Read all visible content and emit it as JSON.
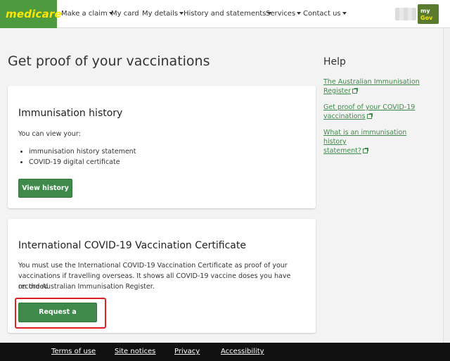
{
  "brand": {
    "name": "medicare",
    "color": "#4e9a3e",
    "text_color": "#ffe600"
  },
  "nav": {
    "items": [
      {
        "label": "Make a claim",
        "has_dropdown": true
      },
      {
        "label": "My card",
        "has_dropdown": false
      },
      {
        "label": "My details",
        "has_dropdown": true
      },
      {
        "label": "History and statements",
        "has_dropdown": true
      },
      {
        "label": "Services",
        "has_dropdown": true
      },
      {
        "label": "Contact us",
        "has_dropdown": true
      }
    ],
    "mygov": {
      "line1": "my",
      "line2": "Gov"
    }
  },
  "page": {
    "title": "Get proof of your vaccinations"
  },
  "immunisation_card": {
    "heading": "Immunisation history",
    "intro": "You can view your:",
    "items": [
      "immunisation history statement",
      "COVID-19 digital certificate"
    ],
    "button_label": "View history"
  },
  "certificate_card": {
    "heading": "International COVID-19 Vaccination Certificate",
    "body_lines": [
      "You must use the International COVID-19 Vaccination Certificate as proof of your",
      "vaccinations if travelling overseas. It shows all COVID-19 vaccine doses you have recorded",
      "on the Australian Immunisation Register."
    ],
    "button_label": "Request a certificate",
    "highlight_color": "#e02020"
  },
  "help": {
    "title": "Help",
    "links": [
      {
        "lines": [
          "The Australian Immunisation",
          "Register"
        ],
        "icon": "external-link-icon"
      },
      {
        "lines": [
          "Get proof of your COVID-19",
          "vaccinations"
        ],
        "icon": "external-link-icon"
      },
      {
        "lines": [
          "What is an immunisation history",
          "statement?"
        ],
        "icon": "external-link-icon"
      }
    ]
  },
  "footer": {
    "links": [
      "Terms of use",
      "Site notices",
      "Privacy",
      "Accessibility"
    ]
  },
  "colors": {
    "primary_button": "#3f8a4b",
    "link": "#3f8a4b",
    "footer_bg": "#111111",
    "page_bg": "#f3f3f3"
  }
}
